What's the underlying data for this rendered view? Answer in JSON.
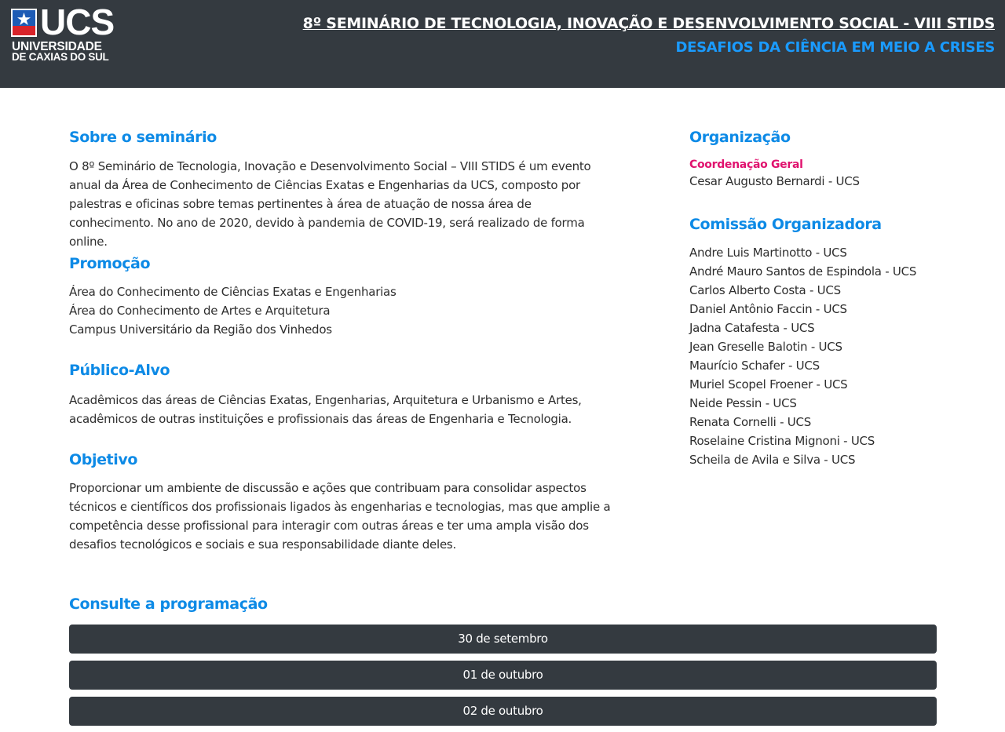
{
  "header": {
    "logo": {
      "wordmark": "UCS",
      "line1": "UNIVERSIDADE",
      "line2": "DE CAXIAS DO SUL"
    },
    "title": "8º SEMINÁRIO DE TECNOLOGIA, INOVAÇÃO E DESENVOLVIMENTO SOCIAL - VIII STIDS",
    "subtitle": "DESAFIOS DA CIÊNCIA EM MEIO A CRISES"
  },
  "main": {
    "sobre": {
      "heading": "Sobre o seminário",
      "text": "O 8º Seminário de Tecnologia, Inovação e Desenvolvimento Social – VIII STIDS é um evento anual da Área de Conhecimento de Ciências Exatas e Engenharias da UCS, composto por palestras e oficinas sobre temas pertinentes à área de atuação de nossa área de conhecimento. No ano de 2020, devido à pandemia de COVID-19, será realizado de forma online."
    },
    "promocao": {
      "heading": "Promoção",
      "items": [
        "Área do Conhecimento de Ciências Exatas e Engenharias",
        "Área do Conhecimento de Artes e Arquitetura",
        "Campus Universitário da Região dos Vinhedos"
      ]
    },
    "publico": {
      "heading": "Público-Alvo",
      "text": "Acadêmicos das áreas de Ciências Exatas, Engenharias, Arquitetura e Urbanismo e Artes, acadêmicos de outras instituições e profissionais das áreas de Engenharia e Tecnologia."
    },
    "objetivo": {
      "heading": "Objetivo",
      "text": "Proporcionar um ambiente de discussão e ações que contribuam para consolidar aspectos técnicos e científicos dos profissionais ligados às engenharias e tecnologias, mas que amplie a competência desse profissional para interagir com outras áreas e ter uma ampla visão dos desafios tecnológicos e sociais e sua responsabilidade diante deles."
    }
  },
  "sidebar": {
    "organizacao": {
      "heading": "Organização",
      "coord_label": "Coordenação Geral",
      "coord_name": "Cesar Augusto Bernardi - UCS"
    },
    "comissao": {
      "heading": "Comissão Organizadora",
      "members": [
        "Andre Luis Martinotto - UCS",
        "André Mauro Santos de Espindola - UCS",
        "Carlos Alberto Costa - UCS",
        "Daniel Antônio Faccin - UCS",
        "Jadna Catafesta - UCS",
        "Jean Greselle Balotin - UCS",
        "Maurício Schafer - UCS",
        "Muriel Scopel Froener - UCS",
        "Neide Pessin - UCS",
        "Renata Cornelli - UCS",
        "Roselaine Cristina Mignoni - UCS",
        "Scheila de Avila e Silva - UCS"
      ]
    }
  },
  "programacao": {
    "heading": "Consulte a programação",
    "days": [
      "30 de setembro",
      "01 de outubro",
      "02 de outubro"
    ]
  },
  "colors": {
    "header_bg": "#343a40",
    "heading_blue": "#0d8ae6",
    "subtitle_blue": "#1a9bff",
    "accent_pink": "#e0126e",
    "button_bg": "#343a40"
  }
}
